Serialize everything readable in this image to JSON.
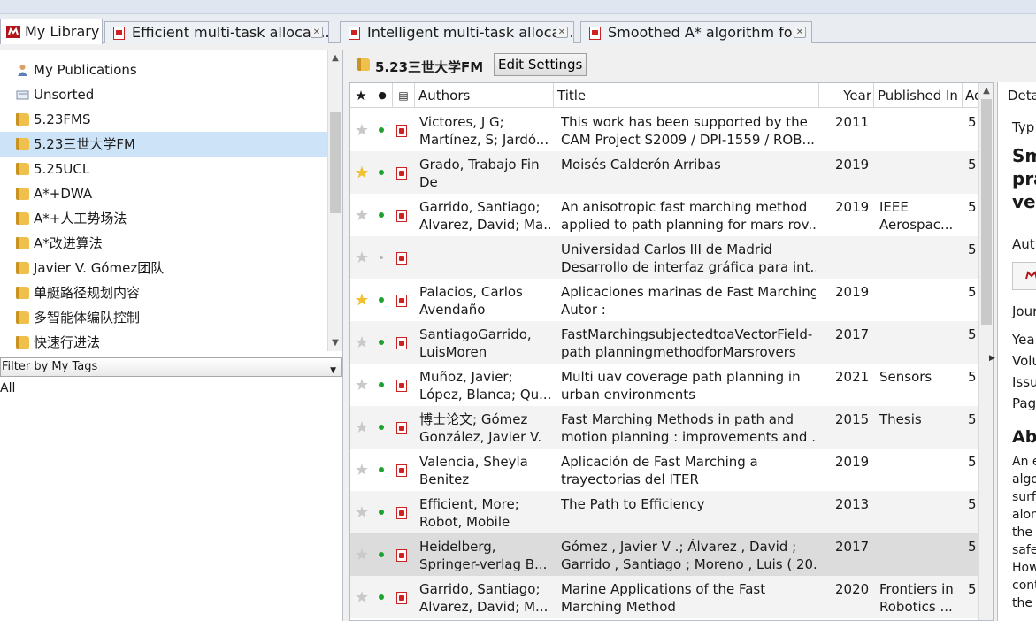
{
  "tabs": [
    {
      "label": "My Library",
      "icon": "mendeley-logo-icon",
      "active": true
    },
    {
      "label": "Efficient multi-task allocati...",
      "icon": "pdf-icon"
    },
    {
      "label": "Intelligent multi-task alloca...",
      "icon": "pdf-icon"
    },
    {
      "label": "Smoothed A* algorithm fo...",
      "icon": "pdf-icon"
    }
  ],
  "sidebar": {
    "items": [
      {
        "label": "My Publications",
        "icon": "person-icon"
      },
      {
        "label": "Unsorted",
        "icon": "tray-icon"
      },
      {
        "label": "5.23FMS",
        "icon": "folder-icon"
      },
      {
        "label": "5.23三世大学FM",
        "icon": "folder-icon",
        "selected": true
      },
      {
        "label": "5.25UCL",
        "icon": "folder-icon"
      },
      {
        "label": "A*+DWA",
        "icon": "folder-icon"
      },
      {
        "label": "A*+人工势场法",
        "icon": "folder-icon"
      },
      {
        "label": "A*改进算法",
        "icon": "folder-icon"
      },
      {
        "label": "Javier V. Gómez团队",
        "icon": "folder-icon"
      },
      {
        "label": "单艇路径规划内容",
        "icon": "folder-icon"
      },
      {
        "label": "多智能体编队控制",
        "icon": "folder-icon"
      },
      {
        "label": "快速行进法",
        "icon": "folder-icon"
      }
    ],
    "tag_filter": "Filter by My Tags",
    "tag_all": "All"
  },
  "collection": {
    "title": "5.23三世大学FM",
    "edit_label": "Edit Settings"
  },
  "columns": {
    "star": "★",
    "read": "●",
    "doc": "▤",
    "authors": "Authors",
    "title": "Title",
    "year": "Year",
    "published": "Published In",
    "added": "Ad"
  },
  "rows": [
    {
      "star": false,
      "read": true,
      "authors": [
        "Victores, J G;",
        "Martínez, S; Jardó..."
      ],
      "title": [
        "This work has been supported by the",
        "CAM Project S2009 / DPI-1559 / ROB..."
      ],
      "year": "2011",
      "published": [
        "",
        ""
      ],
      "added": "5."
    },
    {
      "star": true,
      "read": true,
      "authors": [
        "Grado, Trabajo Fin",
        "De"
      ],
      "title": [
        "Moisés Calderón Arribas",
        ""
      ],
      "year": "2019",
      "published": [
        "",
        ""
      ],
      "added": "5."
    },
    {
      "star": false,
      "read": true,
      "authors": [
        "Garrido, Santiago;",
        "Alvarez, David; Ma..."
      ],
      "title": [
        "An anisotropic fast marching method",
        "applied to path planning for mars rov..."
      ],
      "year": "2019",
      "published": [
        "IEEE",
        "Aerospac..."
      ],
      "added": "5."
    },
    {
      "star": false,
      "read": false,
      "authors": [
        "",
        ""
      ],
      "title": [
        "Universidad Carlos III de Madrid",
        "Desarrollo de interfaz gráfica para int..."
      ],
      "year": "",
      "published": [
        "",
        ""
      ],
      "added": "5."
    },
    {
      "star": true,
      "read": true,
      "authors": [
        "Palacios, Carlos",
        "Avendaño"
      ],
      "title": [
        "Aplicaciones marinas de Fast Marching",
        "Autor :"
      ],
      "year": "2019",
      "published": [
        "",
        ""
      ],
      "added": "5."
    },
    {
      "star": false,
      "read": true,
      "authors": [
        "SantiagoGarrido,",
        "LuisMoren"
      ],
      "title": [
        "FastMarchingsubjectedtoaVectorField-",
        "path planningmethodforMarsrovers"
      ],
      "year": "2017",
      "published": [
        "",
        ""
      ],
      "added": "5."
    },
    {
      "star": false,
      "read": true,
      "authors": [
        "Muñoz, Javier;",
        "López, Blanca; Qu..."
      ],
      "title": [
        "Multi uav coverage path planning in",
        "urban environments"
      ],
      "year": "2021",
      "published": [
        "Sensors",
        ""
      ],
      "added": "5."
    },
    {
      "star": false,
      "read": true,
      "authors": [
        "博士论文; Gómez",
        "González, Javier V."
      ],
      "title": [
        "Fast Marching Methods in path and",
        "motion planning : improvements and ..."
      ],
      "year": "2015",
      "published": [
        "Thesis",
        ""
      ],
      "added": "5."
    },
    {
      "star": false,
      "read": true,
      "authors": [
        "Valencia, Sheyla",
        "Benitez"
      ],
      "title": [
        "Aplicación de Fast Marching a",
        "trayectorias del ITER"
      ],
      "year": "2019",
      "published": [
        "",
        ""
      ],
      "added": "5."
    },
    {
      "star": false,
      "read": true,
      "authors": [
        "Efficient, More;",
        "Robot, Mobile"
      ],
      "title": [
        "The Path to Efficiency",
        ""
      ],
      "year": "2013",
      "published": [
        "",
        ""
      ],
      "added": "5."
    },
    {
      "star": false,
      "read": true,
      "selected": true,
      "authors": [
        "Heidelberg,",
        "Springer-verlag B..."
      ],
      "title": [
        "Gómez , Javier V .; Álvarez , David ;",
        "Garrido , Santiago ; Moreno , Luis ( 20..."
      ],
      "year": "2017",
      "published": [
        "",
        ""
      ],
      "added": "5."
    },
    {
      "star": false,
      "read": true,
      "authors": [
        "Garrido, Santiago;",
        "Alvarez, David; M..."
      ],
      "title": [
        "Marine Applications of the Fast",
        "Marching Method"
      ],
      "year": "2020",
      "published": [
        "Frontiers in",
        "Robotics ..."
      ],
      "added": "5."
    }
  ],
  "details": {
    "tab": "Deta",
    "type_label": "Typ",
    "title_lines": [
      "Sm",
      "pra",
      "vel"
    ],
    "authors_label": "Auth",
    "journal_label": "Jour",
    "year_label": "Year",
    "volume_label": "Volu",
    "issue_label": "Issu",
    "pages_label": "Pag",
    "abstract_label": "Abs",
    "abstract_lines": [
      "An e",
      "algo",
      "surf",
      "alon",
      "the",
      "safe",
      "How",
      "cont",
      "the"
    ]
  }
}
